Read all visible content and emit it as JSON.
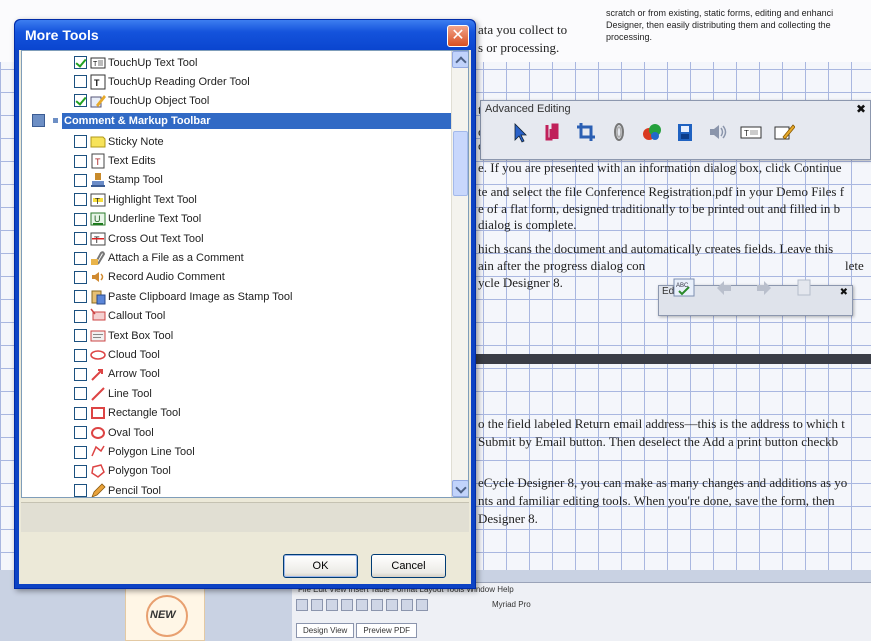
{
  "background_doc": {
    "top_lines": [
      {
        "text": "ata you collect to",
        "size": 13
      },
      {
        "text": "s or processing.",
        "size": 13
      }
    ],
    "top_right_lines": [
      "scratch or from existing, static forms, editing and enhanci",
      "Designer, then easily distributing them and collecting the",
      "processing."
    ],
    "body_lines": [
      "e. If you are presented with an information dialog box, click Continue",
      "te and select the file Conference Registration.pdf in your Demo Files f",
      "e of a flat form, designed traditionally to be printed out and filled in b",
      "dialog is complete.",
      "hich scans the document and automatically creates fields. Leave this",
      "ain after the progress dialog con",
      "ycle Designer 8."
    ],
    "fragments": [
      "t",
      "or",
      "ca"
    ],
    "lower_lines": [
      "o the field labeled Return email address—this is the address to which t",
      "Submit by Email button. Then deselect the Add a print button checkb",
      "eCycle Designer 8, you can make as many changes and additions as yo",
      "nts and familiar editing tools. When you're done, save the form, then",
      "Designer 8."
    ],
    "lete_text": "lete",
    "new_badge": "NEW",
    "app_menu": "File Edit View Insert Table Format Layout Tools Window Help",
    "app_font": "Myriad Pro",
    "app_tabs": [
      "Design View",
      "Preview PDF"
    ]
  },
  "advanced_toolbar": {
    "title": "Advanced Editing",
    "close": "✖",
    "tools": [
      "select-object-icon",
      "form-field-icon",
      "crop-icon",
      "link-icon",
      "3d-object-icon",
      "movie-icon",
      "sound-icon",
      "text-field-icon",
      "touchup-object-icon"
    ]
  },
  "edit_toolbar": {
    "title": "Edit",
    "close": "✖",
    "tools": [
      "spell-check-icon",
      "undo-icon",
      "redo-icon",
      "copy-icon"
    ]
  },
  "dialog": {
    "title": "More Tools",
    "close_label": "✕",
    "tree_items_top": [
      {
        "label": "TouchUp Text Tool",
        "checked": true,
        "icon": "touchup-text-icon"
      },
      {
        "label": "TouchUp Reading Order Tool",
        "checked": false,
        "icon": "reading-order-icon"
      },
      {
        "label": "TouchUp Object Tool",
        "checked": true,
        "icon": "touchup-object-icon"
      }
    ],
    "category": {
      "label": "Comment & Markup Toolbar",
      "checked": "partial"
    },
    "tree_items": [
      {
        "label": "Sticky Note",
        "checked": false,
        "icon": "sticky-note-icon"
      },
      {
        "label": "Text Edits",
        "checked": false,
        "icon": "text-edits-icon"
      },
      {
        "label": "Stamp Tool",
        "checked": false,
        "icon": "stamp-icon"
      },
      {
        "label": "Highlight Text Tool",
        "checked": false,
        "icon": "highlight-icon"
      },
      {
        "label": "Underline Text Tool",
        "checked": false,
        "icon": "underline-icon"
      },
      {
        "label": "Cross Out Text Tool",
        "checked": false,
        "icon": "cross-out-icon"
      },
      {
        "label": "Attach a File as a Comment",
        "checked": false,
        "icon": "attach-file-icon"
      },
      {
        "label": "Record Audio Comment",
        "checked": false,
        "icon": "audio-comment-icon"
      },
      {
        "label": "Paste Clipboard Image as Stamp Tool",
        "checked": false,
        "icon": "paste-stamp-icon"
      },
      {
        "label": "Callout Tool",
        "checked": false,
        "icon": "callout-icon"
      },
      {
        "label": "Text Box Tool",
        "checked": false,
        "icon": "text-box-icon"
      },
      {
        "label": "Cloud Tool",
        "checked": false,
        "icon": "cloud-icon"
      },
      {
        "label": "Arrow Tool",
        "checked": false,
        "icon": "arrow-icon"
      },
      {
        "label": "Line Tool",
        "checked": false,
        "icon": "line-icon"
      },
      {
        "label": "Rectangle Tool",
        "checked": false,
        "icon": "rectangle-icon"
      },
      {
        "label": "Oval Tool",
        "checked": false,
        "icon": "oval-icon"
      },
      {
        "label": "Polygon Line Tool",
        "checked": false,
        "icon": "polygon-line-icon"
      },
      {
        "label": "Polygon Tool",
        "checked": false,
        "icon": "polygon-icon"
      },
      {
        "label": "Pencil Tool",
        "checked": false,
        "icon": "pencil-icon"
      }
    ],
    "ok_label": "OK",
    "cancel_label": "Cancel"
  },
  "colors": {
    "dialog_frame": "#0d43c4",
    "selection": "#316ac5",
    "close_button": "#d74f22"
  }
}
